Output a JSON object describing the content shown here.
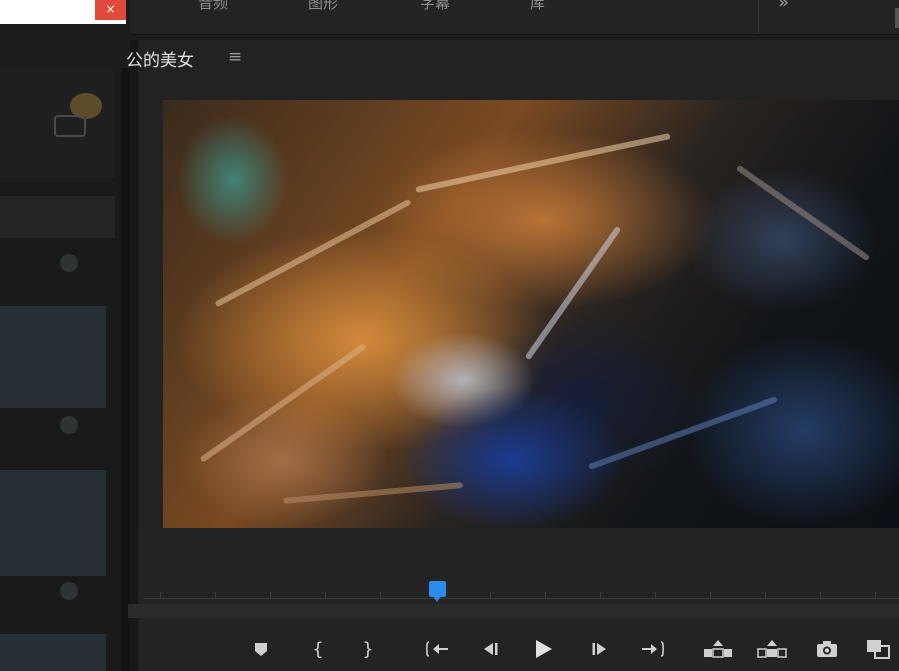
{
  "header": {
    "tabs": [
      {
        "label": "音频"
      },
      {
        "label": "图形"
      },
      {
        "label": "字幕"
      },
      {
        "label": "库"
      }
    ],
    "more_glyph": "»"
  },
  "dialog": {
    "close_glyph": "×"
  },
  "monitor": {
    "title": "公的美女",
    "menu_glyph": "≡"
  },
  "controls": {
    "mark_in_glyph": "{",
    "mark_out_glyph": "}"
  },
  "colors": {
    "accent": "#2d8ceb",
    "panel_bg": "#222222",
    "close_red": "#e04a3b"
  }
}
